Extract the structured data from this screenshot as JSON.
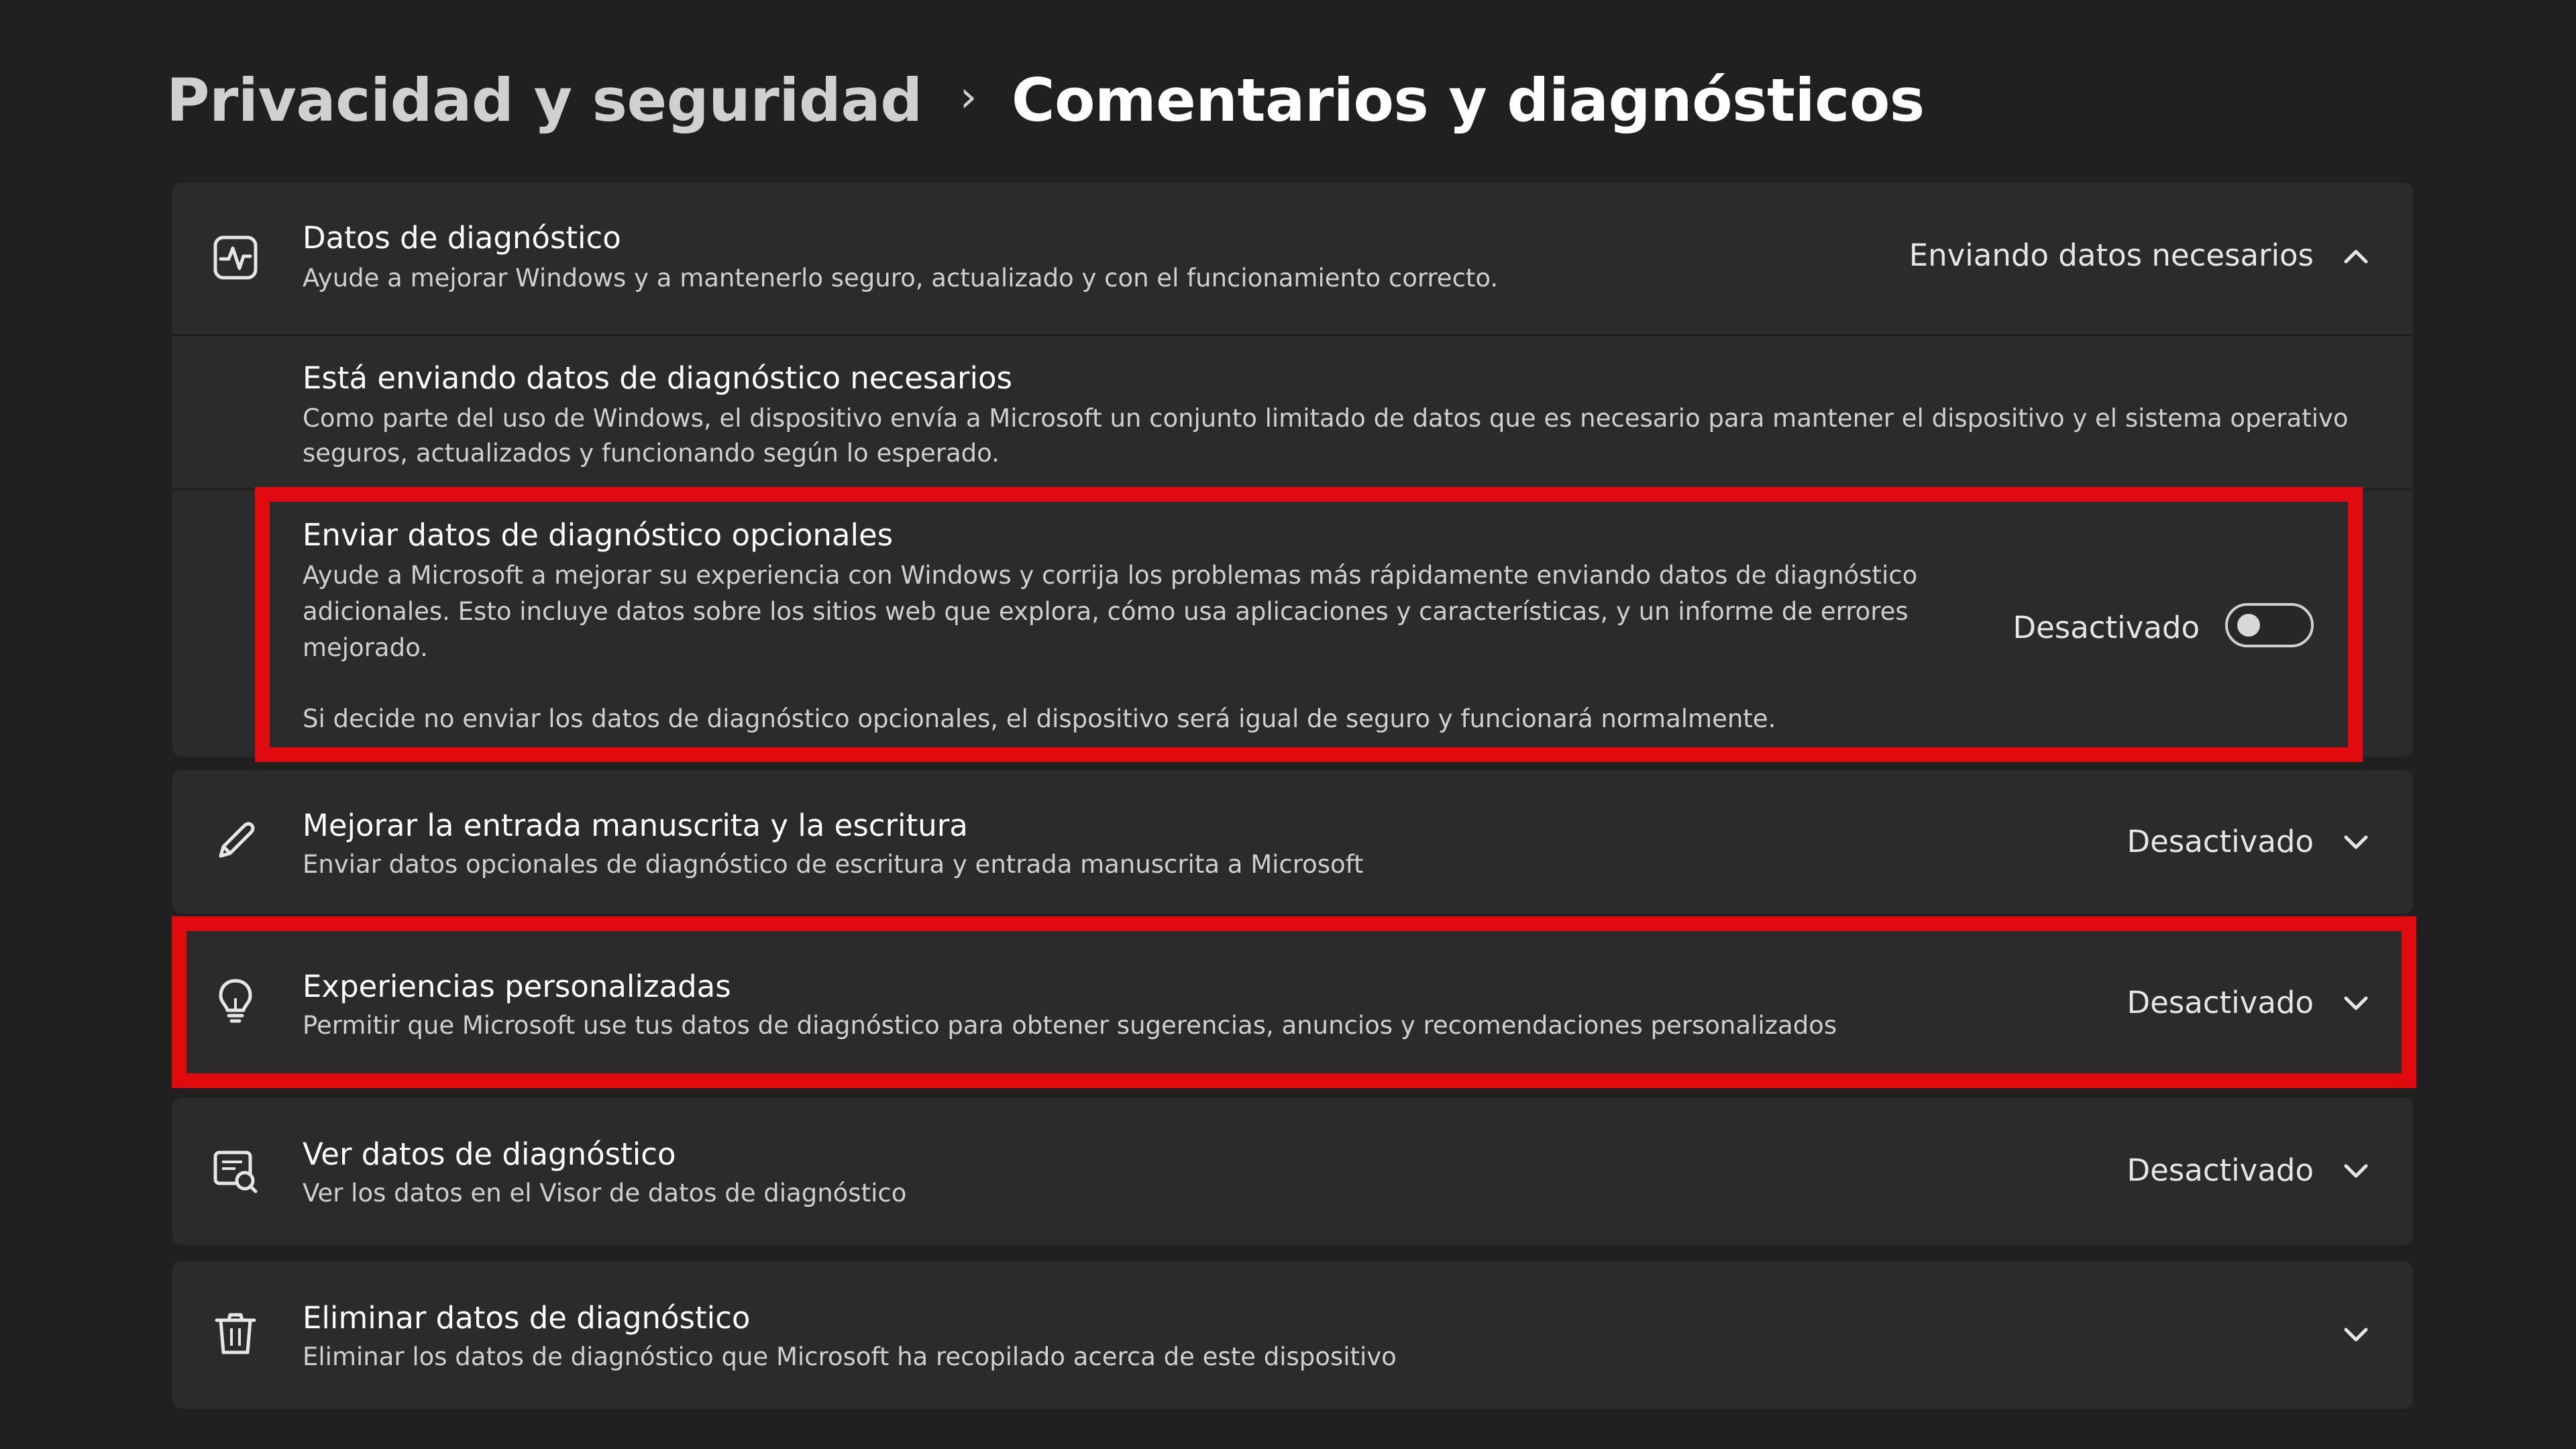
{
  "breadcrumb": {
    "parent": "Privacidad y seguridad",
    "separator": "›",
    "current": "Comentarios y diagnósticos"
  },
  "diagnostic": {
    "title": "Datos de diagnóstico",
    "description": "Ayude a mejorar Windows y a mantenerlo seguro, actualizado y con el funcionamiento correcto.",
    "status": "Enviando datos necesarios",
    "icon": "diagnostic-pulse-icon",
    "required": {
      "title": "Está enviando datos de diagnóstico necesarios",
      "description_line1": "Como parte del uso de Windows, el dispositivo envía a Microsoft un conjunto limitado de datos que es necesario para mantener el dispositivo y el sistema operativo",
      "description_line2": "seguros, actualizados y funcionando según lo esperado."
    },
    "optional": {
      "title": "Enviar datos de diagnóstico opcionales",
      "description_line1": "Ayude a Microsoft a mejorar su experiencia con Windows y corrija los problemas más rápidamente enviando datos de diagnóstico",
      "description_line2": "adicionales. Esto incluye datos sobre los sitios web que explora, cómo usa aplicaciones y características, y un informe de errores",
      "description_line3": "mejorado.",
      "note": "Si decide no enviar los datos de diagnóstico opcionales, el dispositivo será igual de seguro y funcionará normalmente.",
      "toggle_label": "Desactivado",
      "toggle_on": false
    }
  },
  "handwriting": {
    "title": "Mejorar la entrada manuscrita y la escritura",
    "description": "Enviar datos opcionales de diagnóstico de escritura y entrada manuscrita a Microsoft",
    "status": "Desactivado",
    "icon": "pen-icon"
  },
  "tailored": {
    "title": "Experiencias personalizadas",
    "description": "Permitir que Microsoft use tus datos de diagnóstico para obtener sugerencias, anuncios y recomendaciones personalizados",
    "status": "Desactivado",
    "icon": "lightbulb-icon"
  },
  "viewer": {
    "title": "Ver datos de diagnóstico",
    "description": "Ver los datos en el Visor de datos de diagnóstico",
    "status": "Desactivado",
    "icon": "data-viewer-icon"
  },
  "delete": {
    "title": "Eliminar datos de diagnóstico",
    "description": "Eliminar los datos de diagnóstico que Microsoft ha recopilado acerca de este dispositivo",
    "icon": "trash-icon"
  },
  "colors": {
    "background": "#202020",
    "card": "#2b2b2b",
    "highlight": "#e10b0f"
  }
}
